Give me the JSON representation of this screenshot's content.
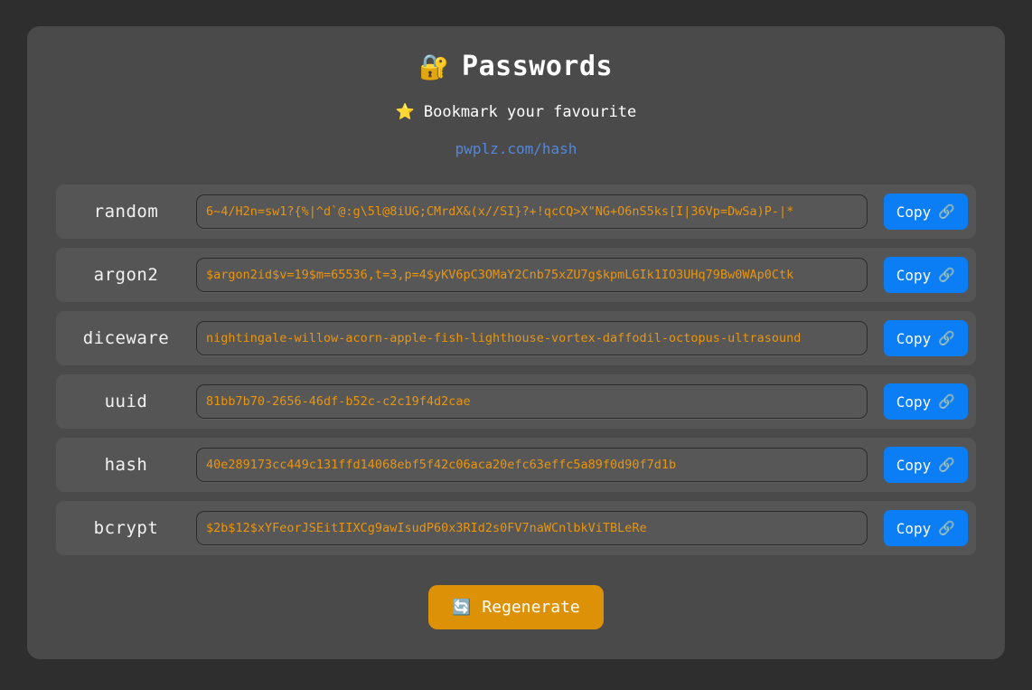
{
  "header": {
    "title": "Passwords",
    "title_icon": "🔐",
    "subtitle": "Bookmark your favourite",
    "subtitle_icon": "⭐",
    "link": "pwplz.com/hash"
  },
  "colors": {
    "page_background": "#2e2e2e",
    "panel_background": "#4a4a4a",
    "row_background": "#555555",
    "value_text": "#e8950f",
    "copy_button": "#0b7df5",
    "regenerate_button": "#dd9106",
    "link_text": "#5487dc"
  },
  "rows": [
    {
      "label": "random",
      "value": "6~4/H2n=sw1?{%|^d`@:g\\5l@8iUG;CMrdX&(x//SI}?+!qcCQ>X\"NG+O6nS5ks[I|36Vp=DwSa)P-|*",
      "copy_label": "Copy",
      "copy_icon": "🔗"
    },
    {
      "label": "argon2",
      "value": "$argon2id$v=19$m=65536,t=3,p=4$yKV6pC3OMaY2Cnb75xZU7g$kpmLGIk1IO3UHq79Bw0WAp0Ctk",
      "copy_label": "Copy",
      "copy_icon": "🔗"
    },
    {
      "label": "diceware",
      "value": "nightingale-willow-acorn-apple-fish-lighthouse-vortex-daffodil-octopus-ultrasound",
      "copy_label": "Copy",
      "copy_icon": "🔗"
    },
    {
      "label": "uuid",
      "value": "81bb7b70-2656-46df-b52c-c2c19f4d2cae",
      "copy_label": "Copy",
      "copy_icon": "🔗"
    },
    {
      "label": "hash",
      "value": "40e289173cc449c131ffd14068ebf5f42c06aca20efc63effc5a89f0d90f7d1b",
      "copy_label": "Copy",
      "copy_icon": "🔗"
    },
    {
      "label": "bcrypt",
      "value": "$2b$12$xYFeorJSEitIIXCg9awIsudP60x3RId2s0FV7naWCnlbkViTBLeRe",
      "copy_label": "Copy",
      "copy_icon": "🔗"
    }
  ],
  "footer": {
    "regenerate_label": "Regenerate",
    "regenerate_icon": "🔄"
  }
}
